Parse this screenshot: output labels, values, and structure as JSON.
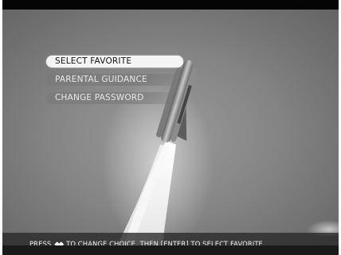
{
  "menu": {
    "items": [
      {
        "label": "SELECT FAVORITE",
        "selected": true
      },
      {
        "label": "PARENTAL GUIDANCE",
        "selected": false
      },
      {
        "label": "CHANGE PASSWORD",
        "selected": false
      }
    ]
  },
  "hint": {
    "prefix": "PRESS",
    "arrows_icon": "left-right-arrows-icon",
    "arrows_glyph": "◆◆",
    "suffix": "TO CHANGE CHOICE. THEN [ENTER] TO SELECT FAVORITE."
  },
  "background": {
    "subject": "space-shuttle-launch"
  }
}
